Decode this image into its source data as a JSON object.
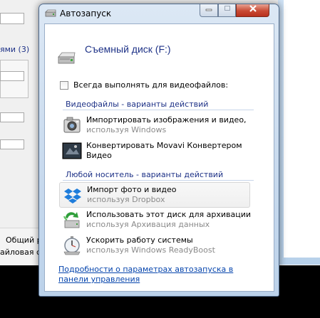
{
  "background": {
    "group_label": "ями (3)",
    "bottom_tab": "Общий р",
    "bottom_text": "айловая сис"
  },
  "window": {
    "title": "Автозапуск",
    "drive_label": "Съемный диск (F:)",
    "always_checkbox_label": "Всегда выполнять для видеофайлов:"
  },
  "sections": [
    {
      "header": "Видеофайлы - варианты действий",
      "items": [
        {
          "line1": "Импортировать изображения и видео,",
          "line2": "используя Windows",
          "icon": "camera-icon"
        },
        {
          "line1": "Конвертировать Movavi Конвертером",
          "line2": "Видео",
          "icon": "movavi-icon"
        }
      ]
    },
    {
      "header": "Любой носитель - варианты действий",
      "items": [
        {
          "line1": "Импорт фото и видео",
          "line2": "используя Dropbox",
          "icon": "dropbox-icon"
        },
        {
          "line1": "Использовать этот диск для архивации",
          "line2": "используя Архивация данных",
          "icon": "backup-icon"
        },
        {
          "line1": "Ускорить работу системы",
          "line2": "используя Windows ReadyBoost",
          "icon": "stopwatch-icon"
        }
      ]
    }
  ],
  "footer": {
    "link": "Подробности о параметрах автозапуска в панели управления"
  },
  "colors": {
    "section_header": "#1e3287",
    "link": "#0645ad",
    "secondary_text": "#8a8a8a",
    "close_button": "#c94a33"
  }
}
